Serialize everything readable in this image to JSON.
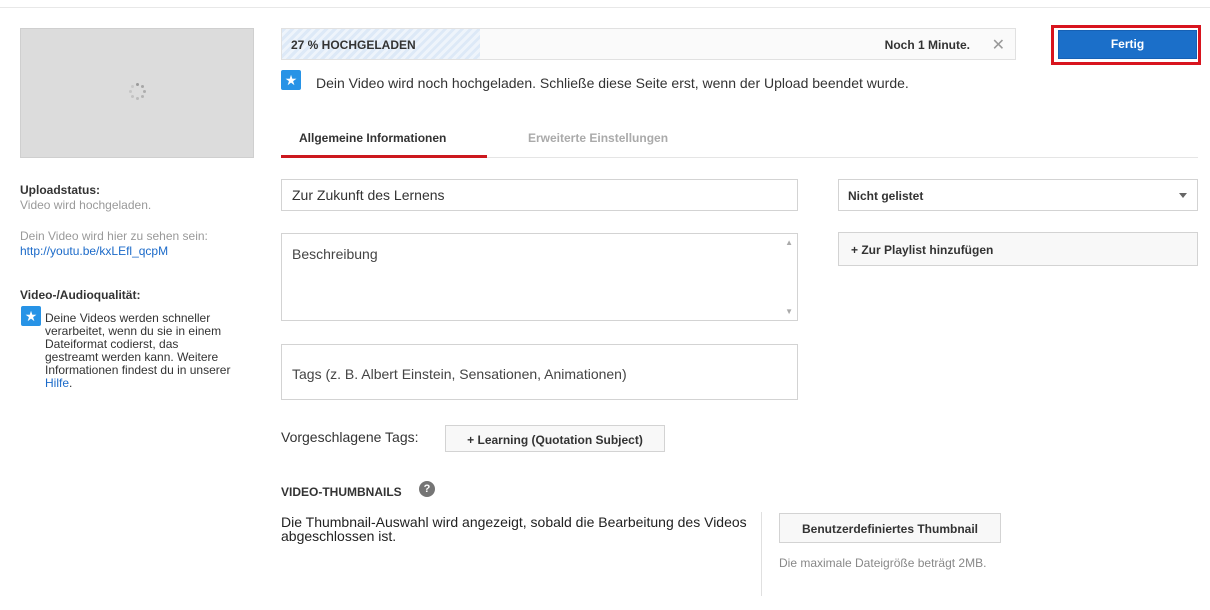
{
  "sidebar": {
    "upload_status_heading": "Uploadstatus:",
    "upload_status_text": "Video wird hochgeladen.",
    "video_link_intro": "Dein Video wird hier zu sehen sein:",
    "video_link": "http://youtu.be/kxLEfl_qcpM",
    "quality_heading": "Video-/Audioqualität:",
    "quality_text": "Deine Videos werden schneller verarbeitet, wenn du sie in einem Dateiformat codierst, das gestreamt werden kann. Weitere Informationen findest du in unserer ",
    "quality_link": "Hilfe",
    "quality_end": "."
  },
  "upload": {
    "progress_label": "27 % HOCHGELADEN",
    "progress_percent": 27,
    "time_remaining": "Noch 1 Minute.",
    "close_glyph": "✕",
    "done_button": "Fertig",
    "notice": "Dein Video wird noch hochgeladen. Schließe diese Seite erst, wenn der Upload beendet wurde."
  },
  "tabs": [
    {
      "label": "Allgemeine Informationen",
      "active": true
    },
    {
      "label": "Erweiterte Einstellungen",
      "active": false
    }
  ],
  "form": {
    "title_value": "Zur Zukunft des Lernens",
    "description_placeholder": "Beschreibung",
    "tags_placeholder": "Tags (z. B. Albert Einstein, Sensationen, Animationen)",
    "privacy_value": "Nicht gelistet",
    "playlist_button": "+ Zur Playlist hinzufügen",
    "suggested_tags_label": "Vorgeschlagene Tags:",
    "suggested_tag": "+ Learning (Quotation Subject)"
  },
  "thumbnails": {
    "heading": "VIDEO-THUMBNAILS",
    "help_glyph": "?",
    "note": "Die Thumbnail-Auswahl wird angezeigt, sobald die Bearbeitung des Videos abgeschlossen ist.",
    "custom_button": "Benutzerdefiniertes Thumbnail",
    "max_size": "Die maximale Dateigröße beträgt 2MB."
  },
  "icons": {
    "star": "★",
    "colors": {
      "accent_blue": "#1b6fc9",
      "tab_red": "#cc181e",
      "outline_red": "#d8141e",
      "info_blue": "#2793e6"
    }
  }
}
